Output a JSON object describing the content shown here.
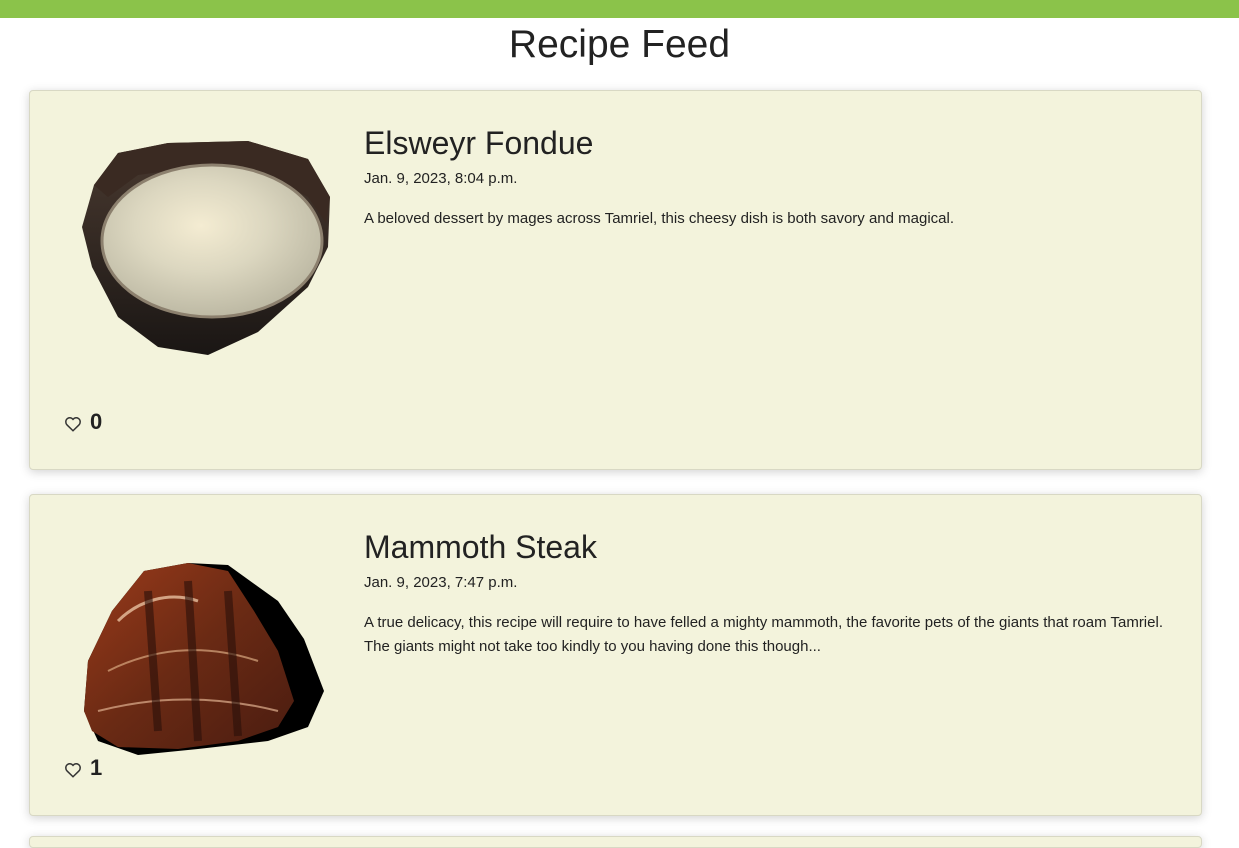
{
  "page": {
    "title": "Recipe Feed",
    "accent_color": "#8bc34a",
    "card_background": "#f3f3dc"
  },
  "recipes": [
    {
      "title": "Elsweyr Fondue",
      "date": "Jan. 9, 2023, 8:04 p.m.",
      "description": "A beloved dessert by mages across Tamriel, this cheesy dish is both savory and magical.",
      "likes": "0",
      "image": "bowl-of-fondue-image",
      "like_icon": "heart-outline-icon"
    },
    {
      "title": "Mammoth Steak",
      "date": "Jan. 9, 2023, 7:47 p.m.",
      "description": "A true delicacy, this recipe will require to have felled a mighty mammoth, the favorite pets of the giants that roam Tamriel. The giants might not take too kindly to you having done this though...",
      "likes": "1",
      "image": "grilled-steak-image",
      "like_icon": "heart-outline-icon"
    }
  ]
}
